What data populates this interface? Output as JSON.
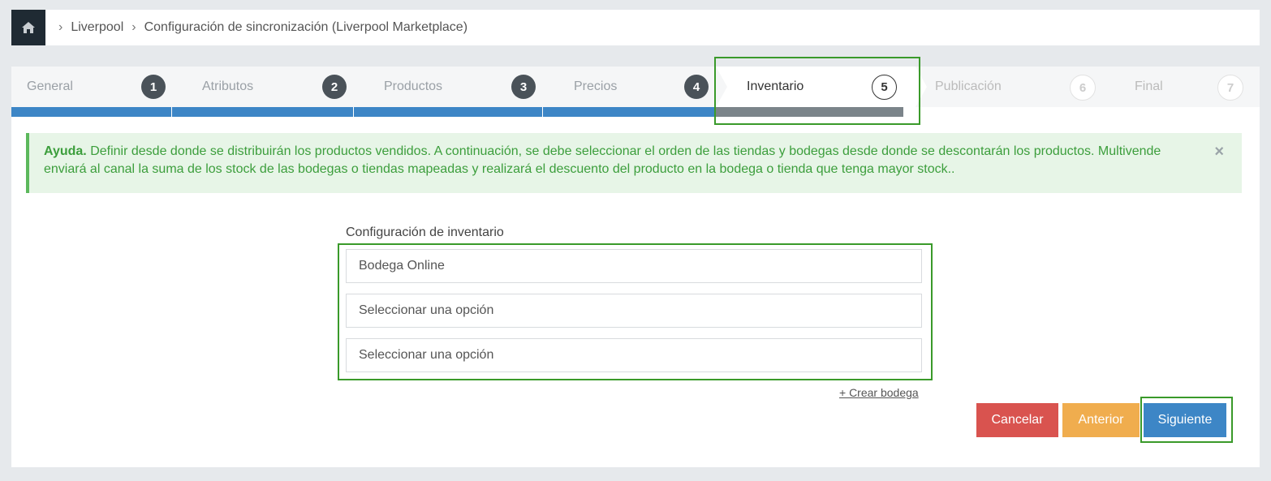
{
  "breadcrumb": {
    "home_icon": "home-icon",
    "items": [
      "Liverpool",
      "Configuración de sincronización (Liverpool Marketplace)"
    ]
  },
  "wizard": {
    "steps": [
      {
        "label": "General",
        "number": "1",
        "state": "done"
      },
      {
        "label": "Atributos",
        "number": "2",
        "state": "done"
      },
      {
        "label": "Productos",
        "number": "3",
        "state": "done"
      },
      {
        "label": "Precios",
        "number": "4",
        "state": "done"
      },
      {
        "label": "Inventario",
        "number": "5",
        "state": "active"
      },
      {
        "label": "Publicación",
        "number": "6",
        "state": "pending"
      },
      {
        "label": "Final",
        "number": "7",
        "state": "pending"
      }
    ]
  },
  "alert": {
    "title": "Ayuda.",
    "text": "Definir desde donde se distribuirán los productos vendidos. A continuación, se debe seleccionar el orden de las tiendas y bodegas desde donde se descontarán los productos. Multivende enviará al canal la suma de los stock de las bodegas o tiendas mapeadas y realizará el descuento del producto en la bodega o tienda que tenga mayor stock..",
    "close": "×"
  },
  "inventory": {
    "label": "Configuración de inventario",
    "selects": [
      "Bodega Online",
      "Seleccionar una opción",
      "Seleccionar una opción"
    ],
    "create_link": "+ Crear bodega"
  },
  "actions": {
    "cancel": "Cancelar",
    "previous": "Anterior",
    "next": "Siguiente"
  },
  "colors": {
    "primary": "#3d86c6",
    "danger": "#d9534f",
    "warning": "#f0ad4e",
    "success": "#5cb85c",
    "dark": "#1f2a33"
  }
}
